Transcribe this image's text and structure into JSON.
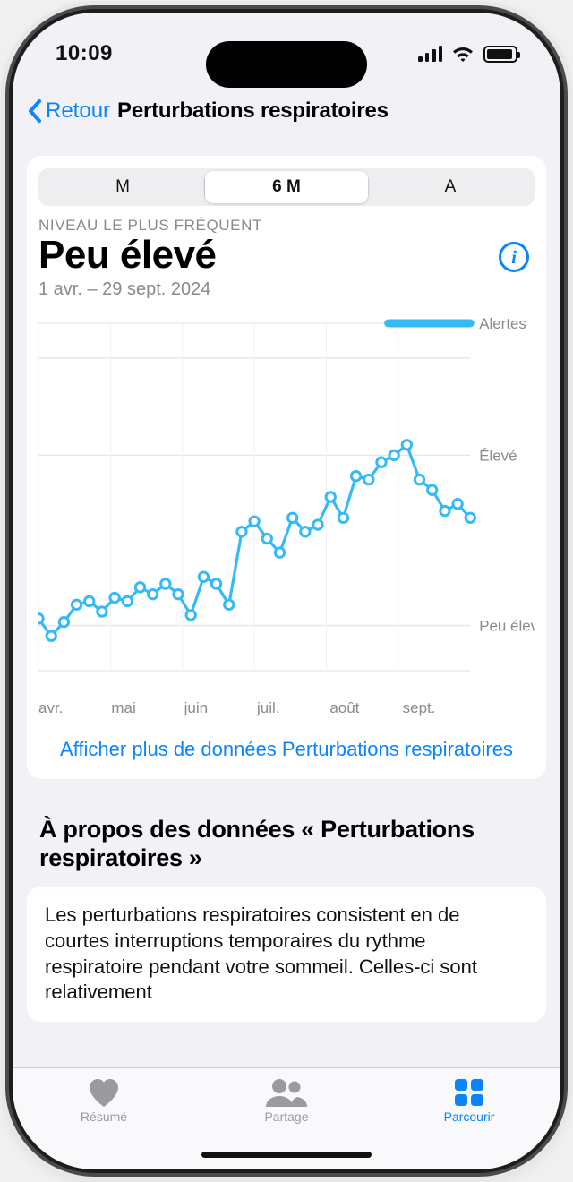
{
  "status": {
    "time": "10:09"
  },
  "nav": {
    "back": "Retour",
    "title": "Perturbations respiratoires"
  },
  "seg": {
    "items": [
      "M",
      "6 M",
      "A"
    ],
    "selected": 1
  },
  "header": {
    "caption": "NIVEAU LE PLUS FRÉQUENT",
    "value": "Peu élevé",
    "range": "1 avr. – 29 sept. 2024"
  },
  "chart_data": {
    "type": "line",
    "xlabel": "",
    "ylabel": "",
    "y_levels": [
      "Alertes",
      "Élevé",
      "Peu élevé"
    ],
    "y_level_positions": [
      1.0,
      0.62,
      0.13
    ],
    "x_ticks": [
      "avr.",
      "mai",
      "juin",
      "juil.",
      "août",
      "sept."
    ],
    "series": [
      {
        "name": "perturbations",
        "color": "#35baf6",
        "values": [
          0.15,
          0.1,
          0.14,
          0.19,
          0.2,
          0.17,
          0.21,
          0.2,
          0.24,
          0.22,
          0.25,
          0.22,
          0.16,
          0.27,
          0.25,
          0.19,
          0.4,
          0.43,
          0.38,
          0.34,
          0.44,
          0.4,
          0.42,
          0.5,
          0.44,
          0.56,
          0.55,
          0.6,
          0.62,
          0.65,
          0.55,
          0.52,
          0.46,
          0.48,
          0.44
        ]
      }
    ],
    "alert_span": {
      "start": 0.81,
      "end": 1.0
    }
  },
  "link": {
    "more": "Afficher plus de données Perturbations respiratoires"
  },
  "about": {
    "title": "À propos des données « Perturbations respiratoires »",
    "body": "Les perturbations respiratoires consistent en de courtes interruptions temporaires du rythme respiratoire pendant votre sommeil. Celles-ci sont relativement"
  },
  "tabs": {
    "items": [
      {
        "label": "Résumé",
        "icon": "heart-icon"
      },
      {
        "label": "Partage",
        "icon": "people-icon"
      },
      {
        "label": "Parcourir",
        "icon": "grid-icon"
      }
    ],
    "active": 2
  },
  "colors": {
    "accent": "#0a84ff",
    "chart": "#35baf6"
  }
}
